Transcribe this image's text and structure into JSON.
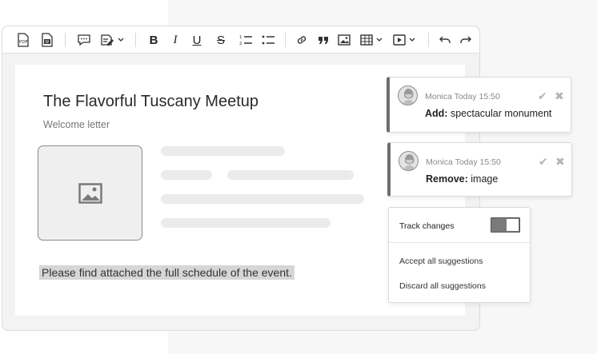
{
  "document": {
    "title": "The Flavorful Tuscany Meetup",
    "subtitle": "Welcome letter",
    "selected_text": "Please find attached the full schedule of the event."
  },
  "toolbar": {
    "items": [
      {
        "name": "export-pdf-icon",
        "icon": "pdf"
      },
      {
        "name": "export-word-icon",
        "icon": "word"
      },
      {
        "name": "comment-icon",
        "icon": "comment"
      },
      {
        "name": "track-changes-icon",
        "icon": "track"
      },
      {
        "name": "bold-icon",
        "label": "B"
      },
      {
        "name": "italic-icon",
        "label": "I"
      },
      {
        "name": "underline-icon",
        "label": "U"
      },
      {
        "name": "strikethrough-icon",
        "label": "S"
      },
      {
        "name": "numbered-list-icon",
        "icon": "numbered-list"
      },
      {
        "name": "bulleted-list-icon",
        "icon": "bulleted-list"
      },
      {
        "name": "link-icon",
        "icon": "link"
      },
      {
        "name": "blockquote-icon",
        "icon": "quote"
      },
      {
        "name": "image-icon",
        "icon": "image"
      },
      {
        "name": "table-icon",
        "icon": "table"
      },
      {
        "name": "media-icon",
        "icon": "media"
      },
      {
        "name": "undo-icon",
        "icon": "undo"
      },
      {
        "name": "redo-icon",
        "icon": "redo"
      }
    ]
  },
  "suggestions": [
    {
      "author": "Monica",
      "time": "Today 15:50",
      "action": "Add:",
      "text": "spectacular monument"
    },
    {
      "author": "Monica",
      "time": "Today 15:50",
      "action": "Remove:",
      "text": "image"
    }
  ],
  "track_changes": {
    "label": "Track changes",
    "enabled": true,
    "accept_all": "Accept all suggestions",
    "discard_all": "Discard all suggestions"
  },
  "colors": {
    "accent": "#6e6e6e",
    "toggle_on": "#7a7a7a"
  }
}
